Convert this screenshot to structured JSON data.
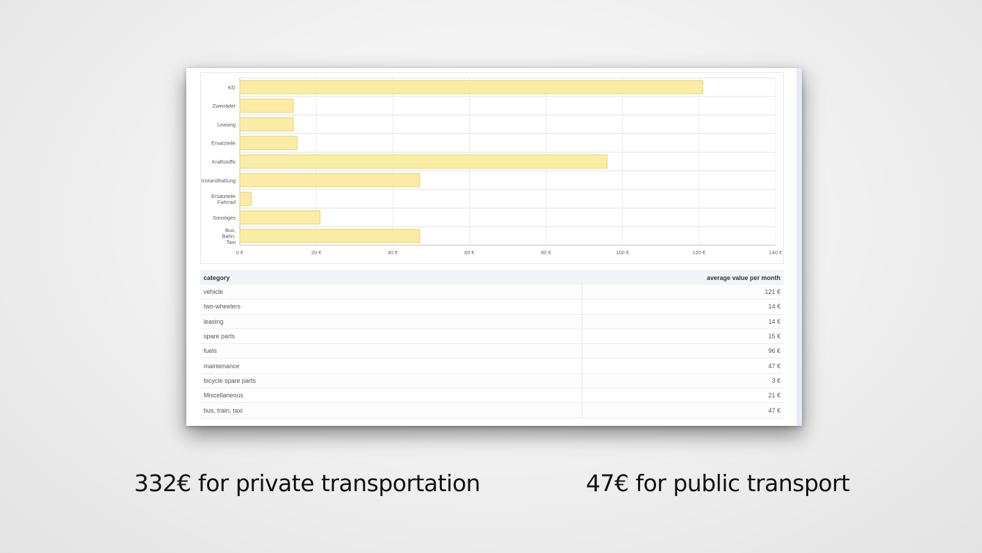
{
  "chart_data": {
    "type": "bar",
    "orientation": "horizontal",
    "categories": [
      "Kfz",
      "Zweiräder",
      "Leasing",
      "Ersatzteile",
      "Kraftstoffe",
      "Instandhaltung",
      "Ersatzteile Fahrrad",
      "Sonstiges",
      "Bus, Bahn, Taxi"
    ],
    "category_lines": [
      [
        "Kfz"
      ],
      [
        "Zweiräder"
      ],
      [
        "Leasing"
      ],
      [
        "Ersatzteile"
      ],
      [
        "Kraftstoffe"
      ],
      [
        "Instandhaltung"
      ],
      [
        "Ersatzteile",
        "Fahrrad"
      ],
      [
        "Sonstiges"
      ],
      [
        "Bus,",
        "Bahn,",
        "Taxi"
      ]
    ],
    "values": [
      121,
      14,
      14,
      15,
      96,
      47,
      3,
      21,
      47
    ],
    "xlim": [
      0,
      140
    ],
    "xticks": [
      0,
      20,
      40,
      60,
      80,
      100,
      120,
      140
    ],
    "tick_suffix": " €",
    "grid": true,
    "bar_fill": "#faeba5",
    "bar_stroke": "#e8d577"
  },
  "table": {
    "headers": {
      "category": "category",
      "value": "average value per month"
    },
    "rows": [
      {
        "category": "vehicle",
        "value": "121 €"
      },
      {
        "category": "two-wheelers",
        "value": "14 €"
      },
      {
        "category": "leasing",
        "value": "14 €"
      },
      {
        "category": "spare parts",
        "value": "15 €"
      },
      {
        "category": "fuels",
        "value": "96 €"
      },
      {
        "category": "maintenance",
        "value": "47 €"
      },
      {
        "category": "bicycle spare parts",
        "value": "3 €"
      },
      {
        "category": "Miscellaneous",
        "value": "21 €"
      },
      {
        "category": "bus, train, taxi",
        "value": "47 €"
      }
    ]
  },
  "captions": {
    "private": "332€ for private transportation",
    "public": "47€ for public transport"
  }
}
